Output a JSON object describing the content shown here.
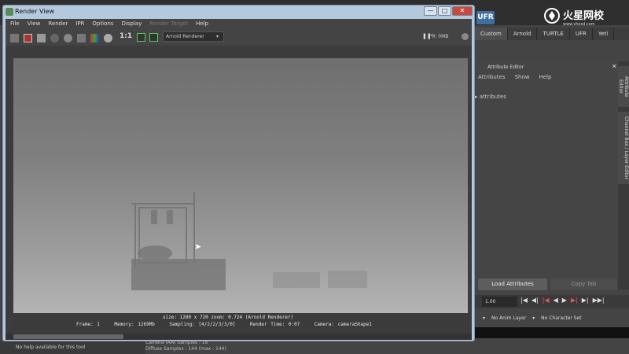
{
  "window": {
    "title": "Render View",
    "controls": {
      "minimize": "—",
      "maximize": "□",
      "close": "✕"
    }
  },
  "menubar": [
    "File",
    "View",
    "Render",
    "IPR",
    "Options",
    "Display",
    "Render Target",
    "Help"
  ],
  "toolbar": {
    "ratio_label": "1:1",
    "renderer": "Arnold Renderer",
    "ipr_status": "IPR: 0MB",
    "icons": [
      "render-icon",
      "render-region-icon",
      "snapshot-icon",
      "ipr-icon",
      "refresh-icon",
      "rgb-icon",
      "alpha-icon",
      "ratio-icon",
      "keep-image-icon",
      "remove-image-icon"
    ]
  },
  "status": {
    "line1": "size: 1280 x 720 zoom: 0.724       (Arnold Renderer)",
    "line2": "Frame: 1    Memory: 1269Mb    Sampling: [4/2/2/3/3/0]    Render Time: 0:07    Camera: cameraShape1"
  },
  "shelf": {
    "tabs": [
      "Custom",
      "Arnold",
      "TURTLE",
      "UFR",
      "Yeti"
    ],
    "logo_badge": "UFR"
  },
  "attribute_editor": {
    "title": "Attribute Editor",
    "menu": [
      "Attributes",
      "Show",
      "Help"
    ],
    "row": "attributes",
    "side_tabs": [
      "Attribute Editor",
      "Channel Box / Layer Editor"
    ],
    "load_button": "Load Attributes",
    "copy_button": "Copy Tab"
  },
  "timeline": {
    "frame": "1.00",
    "anim_layer": "No Anim Layer",
    "character_set": "No Character Set"
  },
  "console": {
    "line1": "Camera (AA) Samples : 16",
    "line2": "Diffuse Samples : 144 (max : 144)"
  },
  "help_line": "No help available for this tool",
  "logo": {
    "text": "火星网校",
    "url": "www.vhxsd.com"
  },
  "colors": {
    "canvas_top": "#6f6f6f",
    "canvas_bottom": "#b4b4b4",
    "title_bar": "#b5c9de",
    "close": "#c94a3c"
  }
}
